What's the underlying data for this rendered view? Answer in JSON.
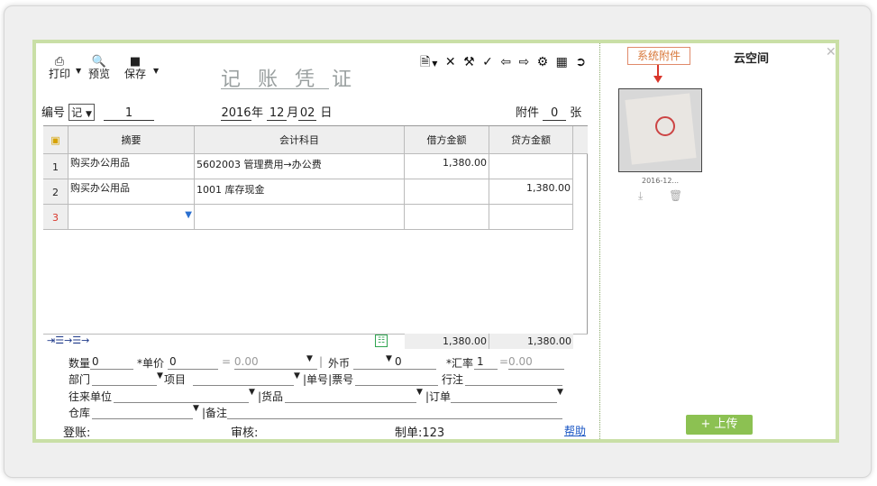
{
  "toolbar": {
    "print": "打印",
    "preview": "预览",
    "save": "保存"
  },
  "voucher_title": "记 账 凭 证",
  "header": {
    "number_label": "编号",
    "type_value": "记",
    "number_value": "1",
    "year": "2016",
    "year_label": "年",
    "month": "12",
    "month_label": "月",
    "day": "02",
    "day_label": "日",
    "attach_label": "附件",
    "attach_count": "0",
    "attach_unit": "张"
  },
  "grid": {
    "columns": [
      "摘要",
      "会计科目",
      "借方金额",
      "贷方金额"
    ],
    "rows": [
      {
        "no": "1",
        "summary": "购买办公用品",
        "account": "5602003 管理费用→办公费",
        "debit": "1,380.00",
        "credit": ""
      },
      {
        "no": "2",
        "summary": "购买办公用品",
        "account": "1001 库存现金",
        "debit": "",
        "credit": "1,380.00"
      },
      {
        "no": "3",
        "summary": "",
        "account": "",
        "debit": "",
        "credit": ""
      }
    ],
    "total_debit": "1,380.00",
    "total_credit": "1,380.00"
  },
  "form": {
    "qty_label": "数量",
    "qty_value": "0",
    "price_label": "*单价",
    "price_value": "0",
    "eq1": "= 0.00",
    "currency_label": "外币",
    "currency_value": "0",
    "rate_label": "*汇率",
    "rate_value": "1",
    "eq2": "=0.00",
    "dept_label": "部门",
    "project_label": "项目",
    "bill_label": "单号",
    "ticket_label": "票号",
    "line_note_label": "行注",
    "partner_label": "往来单位",
    "goods_label": "货品",
    "order_label": "订单",
    "warehouse_label": "仓库",
    "remark_label": "备注"
  },
  "footer": {
    "post_label": "登账:",
    "audit_label": "审核:",
    "maker_label": "制单:123",
    "help_link": "帮助"
  },
  "side": {
    "system_tab": "系统附件",
    "cloud_tab": "云空间",
    "thumb_caption": "2016-12...",
    "upload_label": "+ 上传"
  },
  "colors": {
    "frame_border": "#c9dfa6",
    "upload_green": "#8cc152",
    "arrow_red": "#d9362b",
    "link_blue": "#1a56c4"
  }
}
